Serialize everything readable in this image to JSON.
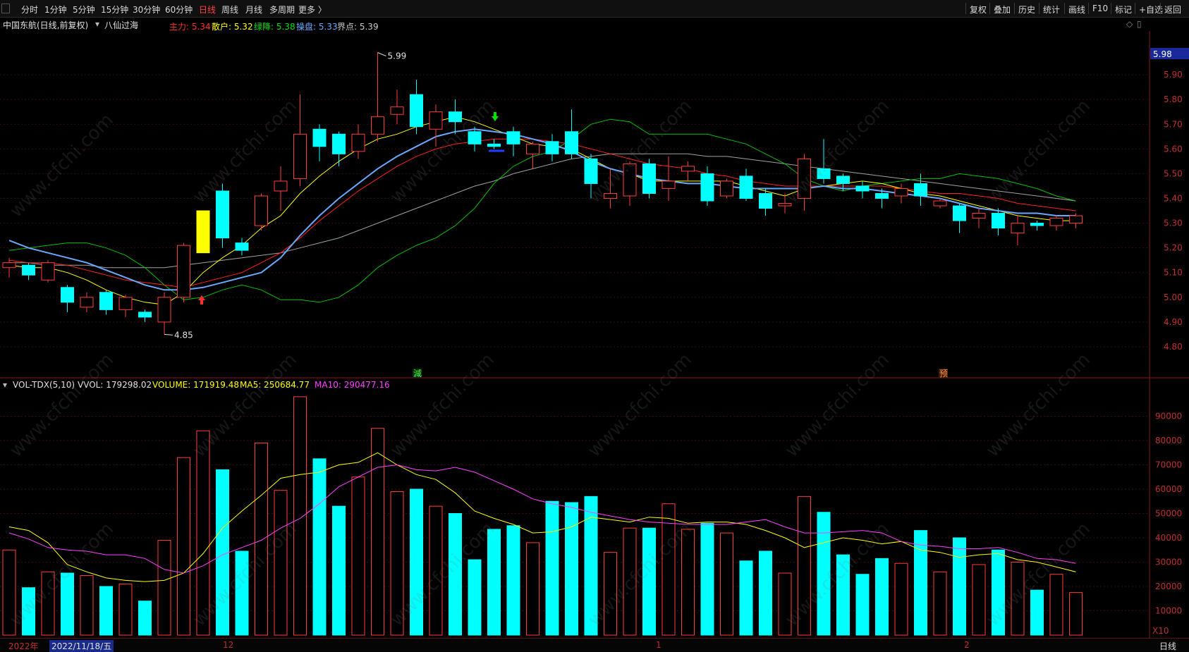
{
  "toolbar": {
    "periods": [
      {
        "label": "分时",
        "active": false
      },
      {
        "label": "1分钟",
        "active": false
      },
      {
        "label": "5分钟",
        "active": false
      },
      {
        "label": "15分钟",
        "active": false
      },
      {
        "label": "30分钟",
        "active": false
      },
      {
        "label": "60分钟",
        "active": false
      },
      {
        "label": "日线",
        "active": true
      },
      {
        "label": "周线",
        "active": false
      },
      {
        "label": "月线",
        "active": false
      },
      {
        "label": "多周期",
        "active": false
      },
      {
        "label": "更多 〉",
        "active": false
      }
    ],
    "right": [
      "复权",
      "叠加",
      "历史",
      "统计",
      "画线",
      "F10",
      "标记",
      "+自选",
      "返回"
    ]
  },
  "info": {
    "stock": "中国东航(日线,前复权)",
    "indicator_select": "▾",
    "indicator": "八仙过海",
    "items": [
      {
        "label": "主力: ",
        "value": "5.34",
        "color": "#ff3030"
      },
      {
        "label": "散户: ",
        "value": "5.32",
        "color": "#ffff00"
      },
      {
        "label": "绿降: ",
        "value": "5.38",
        "color": "#00e000"
      },
      {
        "label": "操盘: ",
        "value": "5.33",
        "color": "#6aa8ff"
      },
      {
        "label": "界点: ",
        "value": "5.39",
        "color": "#c8c8c8"
      }
    ],
    "corner_icons": [
      "◇",
      "▯"
    ]
  },
  "price_axis": {
    "labels": [
      "5.90",
      "5.80",
      "5.70",
      "5.60",
      "5.50",
      "5.40",
      "5.30",
      "5.20",
      "5.10",
      "5.00",
      "4.90",
      "4.80"
    ],
    "current_price": "5.98",
    "high_label": "5.99",
    "low_label": "4.85",
    "marker_jian": "減",
    "marker_yu": "预"
  },
  "volume_panel": {
    "title": "VOL-TDX(5,10)",
    "vvol": "VVOL: 179298.02",
    "volume": "VOLUME: 171919.48",
    "ma5": "MA5: 250684.77",
    "ma10": "MA10: 290477.16",
    "axis_labels": [
      "90000",
      "80000",
      "70000",
      "60000",
      "50000",
      "40000",
      "30000",
      "20000",
      "10000"
    ],
    "multiplier": "X10"
  },
  "bottom": {
    "year": "2022年",
    "cursor_date": "2022/11/18/五",
    "month_ticks": [
      "12",
      "1",
      "2"
    ],
    "period_label": "日线"
  },
  "watermark": "www.cfchi.com",
  "chart_data": {
    "type": "candlestick",
    "price_ylim": [
      4.76,
      6.02
    ],
    "volume_ylim": [
      0,
      100000
    ],
    "candles": [
      {
        "o": 5.12,
        "c": 5.14,
        "h": 5.16,
        "l": 5.08,
        "v": 35000
      },
      {
        "o": 5.13,
        "c": 5.09,
        "h": 5.14,
        "l": 5.07,
        "v": 19500
      },
      {
        "o": 5.07,
        "c": 5.14,
        "h": 5.15,
        "l": 5.06,
        "v": 26000
      },
      {
        "o": 5.04,
        "c": 4.98,
        "h": 5.05,
        "l": 4.94,
        "v": 25500
      },
      {
        "o": 4.96,
        "c": 5.0,
        "h": 5.02,
        "l": 4.94,
        "v": 24500
      },
      {
        "o": 5.02,
        "c": 4.95,
        "h": 5.03,
        "l": 4.93,
        "v": 20000
      },
      {
        "o": 4.95,
        "c": 5.0,
        "h": 5.01,
        "l": 4.92,
        "v": 21000
      },
      {
        "o": 4.94,
        "c": 4.92,
        "h": 4.95,
        "l": 4.9,
        "v": 14000
      },
      {
        "o": 4.9,
        "c": 5.0,
        "h": 5.02,
        "l": 4.85,
        "v": 39000
      },
      {
        "o": 5.0,
        "c": 5.21,
        "h": 5.22,
        "l": 4.98,
        "v": 73000
      },
      {
        "o": 5.18,
        "c": 5.35,
        "h": 5.35,
        "l": 5.18,
        "v": 84000
      },
      {
        "o": 5.43,
        "c": 5.24,
        "h": 5.46,
        "l": 5.2,
        "v": 68000
      },
      {
        "o": 5.22,
        "c": 5.19,
        "h": 5.24,
        "l": 5.17,
        "v": 34500
      },
      {
        "o": 5.29,
        "c": 5.41,
        "h": 5.42,
        "l": 5.27,
        "v": 79000
      },
      {
        "o": 5.43,
        "c": 5.47,
        "h": 5.53,
        "l": 5.35,
        "v": 59500
      },
      {
        "o": 5.48,
        "c": 5.66,
        "h": 5.82,
        "l": 5.45,
        "v": 98000
      },
      {
        "o": 5.68,
        "c": 5.61,
        "h": 5.7,
        "l": 5.55,
        "v": 72500
      },
      {
        "o": 5.66,
        "c": 5.58,
        "h": 5.67,
        "l": 5.53,
        "v": 53000
      },
      {
        "o": 5.59,
        "c": 5.66,
        "h": 5.7,
        "l": 5.56,
        "v": 65000
      },
      {
        "o": 5.66,
        "c": 5.73,
        "h": 5.99,
        "l": 5.63,
        "v": 85000
      },
      {
        "o": 5.74,
        "c": 5.77,
        "h": 5.84,
        "l": 5.7,
        "v": 59000
      },
      {
        "o": 5.82,
        "c": 5.69,
        "h": 5.88,
        "l": 5.66,
        "v": 60000
      },
      {
        "o": 5.68,
        "c": 5.75,
        "h": 5.78,
        "l": 5.61,
        "v": 53000
      },
      {
        "o": 5.75,
        "c": 5.71,
        "h": 5.8,
        "l": 5.66,
        "v": 50000
      },
      {
        "o": 5.67,
        "c": 5.62,
        "h": 5.69,
        "l": 5.59,
        "v": 31000
      },
      {
        "o": 5.62,
        "c": 5.61,
        "h": 5.64,
        "l": 5.6,
        "v": 43500
      },
      {
        "o": 5.67,
        "c": 5.62,
        "h": 5.69,
        "l": 5.57,
        "v": 45000
      },
      {
        "o": 5.58,
        "c": 5.62,
        "h": 5.63,
        "l": 5.52,
        "v": 38000
      },
      {
        "o": 5.63,
        "c": 5.58,
        "h": 5.66,
        "l": 5.55,
        "v": 55000
      },
      {
        "o": 5.67,
        "c": 5.58,
        "h": 5.76,
        "l": 5.56,
        "v": 54500
      },
      {
        "o": 5.56,
        "c": 5.46,
        "h": 5.58,
        "l": 5.4,
        "v": 57000
      },
      {
        "o": 5.4,
        "c": 5.42,
        "h": 5.52,
        "l": 5.36,
        "v": 34000
      },
      {
        "o": 5.41,
        "c": 5.54,
        "h": 5.55,
        "l": 5.37,
        "v": 44000
      },
      {
        "o": 5.54,
        "c": 5.42,
        "h": 5.56,
        "l": 5.4,
        "v": 44000
      },
      {
        "o": 5.44,
        "c": 5.47,
        "h": 5.57,
        "l": 5.39,
        "v": 54000
      },
      {
        "o": 5.51,
        "c": 5.53,
        "h": 5.55,
        "l": 5.47,
        "v": 43500
      },
      {
        "o": 5.5,
        "c": 5.39,
        "h": 5.53,
        "l": 5.37,
        "v": 46000
      },
      {
        "o": 5.41,
        "c": 5.47,
        "h": 5.48,
        "l": 5.4,
        "v": 42000
      },
      {
        "o": 5.49,
        "c": 5.4,
        "h": 5.52,
        "l": 5.39,
        "v": 30500
      },
      {
        "o": 5.42,
        "c": 5.36,
        "h": 5.44,
        "l": 5.33,
        "v": 34500
      },
      {
        "o": 5.37,
        "c": 5.38,
        "h": 5.42,
        "l": 5.34,
        "v": 25500
      },
      {
        "o": 5.4,
        "c": 5.56,
        "h": 5.58,
        "l": 5.35,
        "v": 57000
      },
      {
        "o": 5.52,
        "c": 5.48,
        "h": 5.64,
        "l": 5.46,
        "v": 50500
      },
      {
        "o": 5.49,
        "c": 5.46,
        "h": 5.5,
        "l": 5.43,
        "v": 33000
      },
      {
        "o": 5.45,
        "c": 5.43,
        "h": 5.47,
        "l": 5.4,
        "v": 25000
      },
      {
        "o": 5.42,
        "c": 5.4,
        "h": 5.44,
        "l": 5.36,
        "v": 31500
      },
      {
        "o": 5.41,
        "c": 5.44,
        "h": 5.46,
        "l": 5.38,
        "v": 29500
      },
      {
        "o": 5.46,
        "c": 5.41,
        "h": 5.5,
        "l": 5.37,
        "v": 43000
      },
      {
        "o": 5.37,
        "c": 5.39,
        "h": 5.4,
        "l": 5.36,
        "v": 26000
      },
      {
        "o": 5.37,
        "c": 5.31,
        "h": 5.38,
        "l": 5.26,
        "v": 40000
      },
      {
        "o": 5.32,
        "c": 5.34,
        "h": 5.36,
        "l": 5.28,
        "v": 29000
      },
      {
        "o": 5.34,
        "c": 5.28,
        "h": 5.36,
        "l": 5.25,
        "v": 35000
      },
      {
        "o": 5.26,
        "c": 5.3,
        "h": 5.33,
        "l": 5.21,
        "v": 30000
      },
      {
        "o": 5.3,
        "c": 5.29,
        "h": 5.31,
        "l": 5.27,
        "v": 18500
      },
      {
        "o": 5.29,
        "c": 5.32,
        "h": 5.33,
        "l": 5.27,
        "v": 25000
      },
      {
        "o": 5.3,
        "c": 5.33,
        "h": 5.34,
        "l": 5.28,
        "v": 17500
      }
    ],
    "ma5": [
      5.13,
      5.12,
      5.12,
      5.1,
      5.07,
      5.03,
      5.0,
      4.98,
      4.97,
      5.02,
      5.1,
      5.16,
      5.21,
      5.28,
      5.33,
      5.42,
      5.49,
      5.55,
      5.6,
      5.64,
      5.66,
      5.69,
      5.71,
      5.73,
      5.71,
      5.68,
      5.65,
      5.62,
      5.61,
      5.6,
      5.56,
      5.52,
      5.5,
      5.47,
      5.47,
      5.47,
      5.47,
      5.47,
      5.45,
      5.43,
      5.41,
      5.44,
      5.45,
      5.46,
      5.47,
      5.46,
      5.44,
      5.42,
      5.41,
      5.39,
      5.37,
      5.35,
      5.33,
      5.32,
      5.31,
      5.31
    ],
    "ma10": [
      5.15,
      5.14,
      5.14,
      5.13,
      5.11,
      5.09,
      5.07,
      5.06,
      5.05,
      5.04,
      5.06,
      5.08,
      5.1,
      5.14,
      5.18,
      5.24,
      5.31,
      5.37,
      5.43,
      5.48,
      5.53,
      5.57,
      5.6,
      5.62,
      5.63,
      5.64,
      5.64,
      5.64,
      5.63,
      5.62,
      5.6,
      5.58,
      5.56,
      5.54,
      5.53,
      5.52,
      5.5,
      5.49,
      5.47,
      5.46,
      5.45,
      5.45,
      5.45,
      5.45,
      5.45,
      5.45,
      5.44,
      5.43,
      5.42,
      5.42,
      5.41,
      5.4,
      5.38,
      5.37,
      5.36,
      5.35
    ],
    "ma60": [
      5.14,
      5.14,
      5.13,
      5.13,
      5.13,
      5.12,
      5.12,
      5.12,
      5.12,
      5.13,
      5.14,
      5.15,
      5.16,
      5.17,
      5.18,
      5.2,
      5.22,
      5.24,
      5.27,
      5.3,
      5.33,
      5.36,
      5.39,
      5.42,
      5.45,
      5.47,
      5.5,
      5.52,
      5.54,
      5.56,
      5.57,
      5.58,
      5.58,
      5.58,
      5.58,
      5.58,
      5.57,
      5.57,
      5.56,
      5.55,
      5.54,
      5.53,
      5.52,
      5.51,
      5.5,
      5.49,
      5.48,
      5.47,
      5.46,
      5.45,
      5.44,
      5.43,
      5.42,
      5.41,
      5.4,
      5.39
    ],
    "trend_blue": [
      5.23,
      5.2,
      5.18,
      5.16,
      5.14,
      5.11,
      5.08,
      5.05,
      5.03,
      5.03,
      5.04,
      5.06,
      5.08,
      5.1,
      5.16,
      5.25,
      5.33,
      5.4,
      5.46,
      5.52,
      5.57,
      5.61,
      5.65,
      5.67,
      5.68,
      5.67,
      5.66,
      5.64,
      5.62,
      5.59,
      5.55,
      5.52,
      5.5,
      5.48,
      5.47,
      5.46,
      5.46,
      5.45,
      5.44,
      5.44,
      5.44,
      5.44,
      5.45,
      5.44,
      5.44,
      5.43,
      5.42,
      5.41,
      5.4,
      5.38,
      5.36,
      5.35,
      5.34,
      5.34,
      5.33,
      5.33
    ],
    "band_green": [
      5.19,
      5.2,
      5.21,
      5.22,
      5.22,
      5.2,
      5.17,
      5.12,
      5.05,
      4.99,
      5.0,
      5.03,
      5.05,
      5.03,
      4.99,
      4.99,
      4.98,
      5.0,
      5.05,
      5.12,
      5.17,
      5.21,
      5.24,
      5.29,
      5.36,
      5.46,
      5.53,
      5.57,
      5.59,
      5.64,
      5.7,
      5.72,
      5.71,
      5.66,
      5.66,
      5.66,
      5.66,
      5.64,
      5.62,
      5.58,
      5.54,
      5.48,
      5.45,
      5.43,
      5.45,
      5.46,
      5.47,
      5.48,
      5.48,
      5.5,
      5.49,
      5.48,
      5.46,
      5.44,
      5.41,
      5.39
    ],
    "vol_ma5": [
      44500,
      43000,
      38000,
      29000,
      26000,
      23500,
      22500,
      22000,
      22500,
      25500,
      33500,
      44000,
      51000,
      57500,
      64500,
      66000,
      67000,
      70000,
      71000,
      75000,
      70000,
      66000,
      64000,
      58500,
      51000,
      48000,
      45500,
      42000,
      42500,
      44500,
      48500,
      47500,
      46500,
      48500,
      48000,
      46000,
      46500,
      46500,
      45500,
      43000,
      40000,
      36000,
      38000,
      40000,
      39000,
      37500,
      38500,
      35000,
      34000,
      32000,
      33000,
      33500,
      31000,
      30000,
      28000,
      26000
    ],
    "vol_ma10": [
      42000,
      39500,
      36000,
      35000,
      34500,
      33000,
      33000,
      31500,
      27000,
      25500,
      28500,
      33000,
      36000,
      39000,
      44000,
      48000,
      54000,
      61000,
      65000,
      69000,
      70000,
      68000,
      67500,
      69000,
      67000,
      63500,
      60000,
      56000,
      54000,
      52500,
      50500,
      49000,
      47500,
      46500,
      46000,
      45500,
      45500,
      45500,
      46500,
      47500,
      44500,
      42000,
      42000,
      42500,
      43000,
      42000,
      38500,
      37000,
      36500,
      35500,
      35500,
      36000,
      34000,
      31500,
      31000,
      29500
    ]
  }
}
